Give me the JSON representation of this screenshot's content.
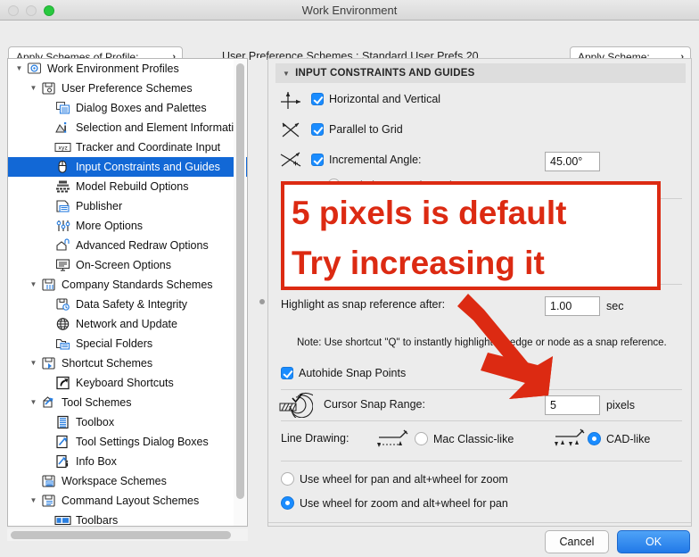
{
  "window": {
    "title": "Work Environment",
    "traffic_lights": [
      "close-button",
      "minimize-button",
      "zoom-button"
    ]
  },
  "scheme_bar": {
    "apply_profile_label": "Apply Schemes of Profile:",
    "apply_profile_chevron": "›",
    "caption": "User Preference Schemes :  Standard User Prefs 20",
    "apply_scheme_label": "Apply Scheme:",
    "apply_scheme_chevron": "›"
  },
  "tree": {
    "items": [
      {
        "label": "Work Environment Profiles",
        "depth": 0,
        "twisty": "▼",
        "icon": "work-environment-profiles-icon",
        "selected": false
      },
      {
        "label": "User Preference Schemes",
        "depth": 1,
        "twisty": "▼",
        "icon": "user-preference-schemes-icon",
        "selected": false
      },
      {
        "label": "Dialog Boxes and Palettes",
        "depth": 2,
        "twisty": "",
        "icon": "dialog-boxes-palettes-icon",
        "selected": false
      },
      {
        "label": "Selection and Element Information",
        "depth": 2,
        "twisty": "",
        "icon": "selection-element-info-icon",
        "selected": false
      },
      {
        "label": "Tracker and Coordinate Input",
        "depth": 2,
        "twisty": "",
        "icon": "tracker-coordinate-input-icon",
        "selected": false
      },
      {
        "label": "Input Constraints and Guides",
        "depth": 2,
        "twisty": "",
        "icon": "input-constraints-guides-icon",
        "selected": true
      },
      {
        "label": "Model Rebuild Options",
        "depth": 2,
        "twisty": "",
        "icon": "model-rebuild-options-icon",
        "selected": false
      },
      {
        "label": "Publisher",
        "depth": 2,
        "twisty": "",
        "icon": "publisher-icon",
        "selected": false
      },
      {
        "label": "More Options",
        "depth": 2,
        "twisty": "",
        "icon": "more-options-icon",
        "selected": false
      },
      {
        "label": "Advanced Redraw Options",
        "depth": 2,
        "twisty": "",
        "icon": "advanced-redraw-options-icon",
        "selected": false
      },
      {
        "label": "On-Screen Options",
        "depth": 2,
        "twisty": "",
        "icon": "on-screen-options-icon",
        "selected": false
      },
      {
        "label": "Company Standards Schemes",
        "depth": 1,
        "twisty": "▼",
        "icon": "company-standards-schemes-icon",
        "selected": false
      },
      {
        "label": "Data Safety & Integrity",
        "depth": 2,
        "twisty": "",
        "icon": "data-safety-integrity-icon",
        "selected": false
      },
      {
        "label": "Network and Update",
        "depth": 2,
        "twisty": "",
        "icon": "network-update-icon",
        "selected": false
      },
      {
        "label": "Special Folders",
        "depth": 2,
        "twisty": "",
        "icon": "special-folders-icon",
        "selected": false
      },
      {
        "label": "Shortcut Schemes",
        "depth": 1,
        "twisty": "▼",
        "icon": "shortcut-schemes-icon",
        "selected": false
      },
      {
        "label": "Keyboard Shortcuts",
        "depth": 2,
        "twisty": "",
        "icon": "keyboard-shortcuts-icon",
        "selected": false
      },
      {
        "label": "Tool Schemes",
        "depth": 1,
        "twisty": "▼",
        "icon": "tool-schemes-icon",
        "selected": false
      },
      {
        "label": "Toolbox",
        "depth": 2,
        "twisty": "",
        "icon": "toolbox-icon",
        "selected": false
      },
      {
        "label": "Tool Settings Dialog Boxes",
        "depth": 2,
        "twisty": "",
        "icon": "tool-settings-dialog-boxes-icon",
        "selected": false
      },
      {
        "label": "Info Box",
        "depth": 2,
        "twisty": "",
        "icon": "info-box-icon",
        "selected": false
      },
      {
        "label": "Workspace Schemes",
        "depth": 1,
        "twisty": "",
        "icon": "workspace-schemes-icon",
        "selected": false
      },
      {
        "label": "Command Layout Schemes",
        "depth": 1,
        "twisty": "▼",
        "icon": "command-layout-schemes-icon",
        "selected": false
      },
      {
        "label": "Toolbars",
        "depth": 2,
        "twisty": "",
        "icon": "toolbars-icon",
        "selected": false
      }
    ]
  },
  "panel": {
    "section_title": "INPUT CONSTRAINTS AND GUIDES",
    "section_triangle": "▼",
    "horizontal_vertical_label": "Horizontal and Vertical",
    "parallel_to_grid_label": "Parallel to Grid",
    "incremental_angle_label": "Incremental Angle:",
    "incremental_angle_value": "45.00°",
    "relative_to_horizontal_label": "Relative to Horizontal",
    "highlight_snap_label": "Highlight as snap reference after:",
    "highlight_snap_value": "1.00",
    "highlight_snap_unit": "sec",
    "note": "Note: Use shortcut \"Q\" to instantly highlight an edge or node as a snap reference.",
    "autohide_snap_points_label": "Autohide Snap Points",
    "cursor_snap_range_label": "Cursor Snap Range:",
    "cursor_snap_range_value": "5",
    "cursor_snap_range_unit": "pixels",
    "line_drawing_label": "Line Drawing:",
    "mac_classic_label": "Mac Classic-like",
    "cad_like_label": "CAD-like",
    "wheel_pan_label": "Use wheel for pan and alt+wheel for zoom",
    "wheel_zoom_label": "Use wheel for zoom and alt+wheel for pan"
  },
  "footer": {
    "cancel_label": "Cancel",
    "ok_label": "OK"
  },
  "annotation": {
    "line1": "5 pixels is default",
    "line2": "Try increasing it",
    "color": "#dc2a12"
  },
  "colors": {
    "selection_blue": "#1268d6",
    "control_blue": "#1a8cff",
    "ok_blue": "#2179e8",
    "annotation_red": "#dc2a12",
    "window_bg": "#ececec"
  }
}
